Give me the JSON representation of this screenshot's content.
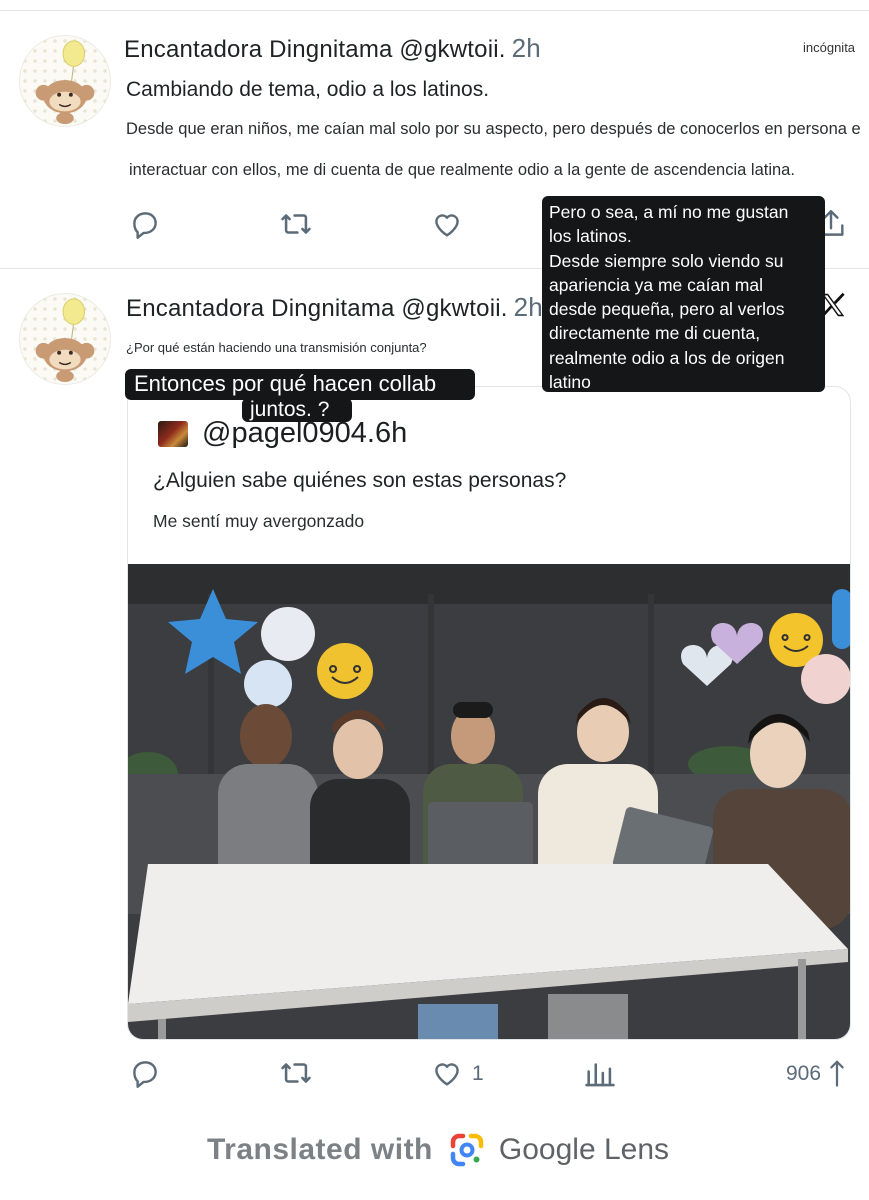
{
  "tweet1": {
    "author": "Encantadora Dingnitama @gkwtoii.",
    "time": "2h",
    "badge": "incógnita",
    "text_line1": "Cambiando de tema, odio a los latinos.",
    "text_line2": "Desde que eran niños, me caían mal solo por su aspecto, pero después de conocerlos en persona e",
    "text_line3": "interactuar con ellos, me di cuenta de que realmente odio a la gente de ascendencia latina."
  },
  "tweet2": {
    "author": "Encantadora Dingnitama @gkwtoii.",
    "time": "2h",
    "text": "¿Por qué están haciendo una transmisión conjunta?",
    "likes": "1",
    "views_right": "906"
  },
  "overlay_left": {
    "line1": "Entonces por qué hacen collab",
    "line2": "juntos. ?"
  },
  "overlay_right": {
    "lines": [
      "Pero o sea, a mí no me gustan",
      "los latinos.",
      "Desde siempre solo viendo su",
      "apariencia ya me caían mal",
      "desde pequeña, pero al verlos",
      "directamente me di cuenta,",
      "realmente odio a los de origen",
      "latino"
    ]
  },
  "quote": {
    "handle": "@pagel0904.6h",
    "text": "¿Alguien sabe quiénes son estas personas?",
    "subtext": "Me sentí muy avergonzado"
  },
  "footer": {
    "translated_label": "Translated with",
    "brand_word1": "Google",
    "brand_word2": "Lens"
  },
  "colors": {
    "text": "#0f1419",
    "muted": "#5b6b78",
    "bubble_bg": "#151617",
    "divider": "#e4e6e8"
  },
  "icons": {
    "reply": "reply-icon",
    "retweet": "retweet-icon",
    "like": "heart-icon",
    "bookmark": "bookmark-icon",
    "share": "share-icon",
    "views": "views-icon"
  }
}
